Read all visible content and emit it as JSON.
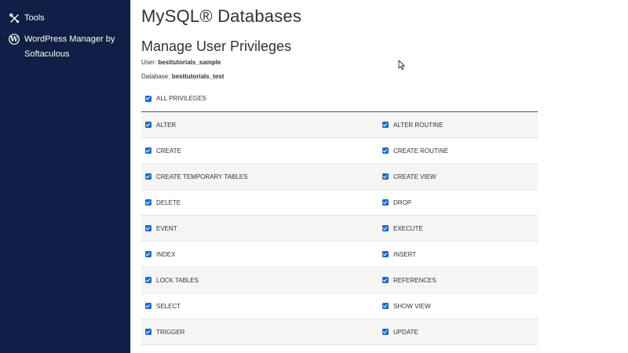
{
  "sidebar": {
    "items": [
      {
        "label": "Tools",
        "icon": "tools-icon"
      },
      {
        "label": "WordPress Manager by Softaculous",
        "icon": "wordpress-icon"
      }
    ]
  },
  "main": {
    "title": "MySQL® Databases",
    "section_title": "Manage User Privileges",
    "user_label": "User:",
    "user_value": "besttutorials_sample",
    "database_label": "Database:",
    "database_value": "besttutorials_test",
    "all_privileges": {
      "label": "ALL PRIVILEGES",
      "checked": true
    },
    "privileges": [
      [
        "ALTER",
        "ALTER ROUTINE"
      ],
      [
        "CREATE",
        "CREATE ROUTINE"
      ],
      [
        "CREATE TEMPORARY TABLES",
        "CREATE VIEW"
      ],
      [
        "DELETE",
        "DROP"
      ],
      [
        "EVENT",
        "EXECUTE"
      ],
      [
        "INDEX",
        "INSERT"
      ],
      [
        "LOCK TABLES",
        "REFERENCES"
      ],
      [
        "SELECT",
        "SHOW VIEW"
      ],
      [
        "TRIGGER",
        "UPDATE"
      ]
    ],
    "checkbox_color": "#1c6bc6"
  },
  "colors": {
    "sidebar_bg": "#0f1f45",
    "row_stripe": "#f5f5f5"
  }
}
